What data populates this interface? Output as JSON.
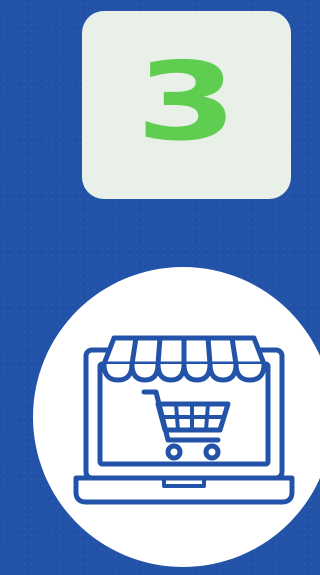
{
  "step": {
    "number": "3"
  },
  "icon": {
    "name": "laptop-shopping-cart-icon"
  },
  "colors": {
    "background": "#2353a8",
    "badge_background": "#e8f0e8",
    "number_color": "#5fcd4f",
    "icon_stroke": "#2353a8",
    "circle": "#ffffff"
  }
}
